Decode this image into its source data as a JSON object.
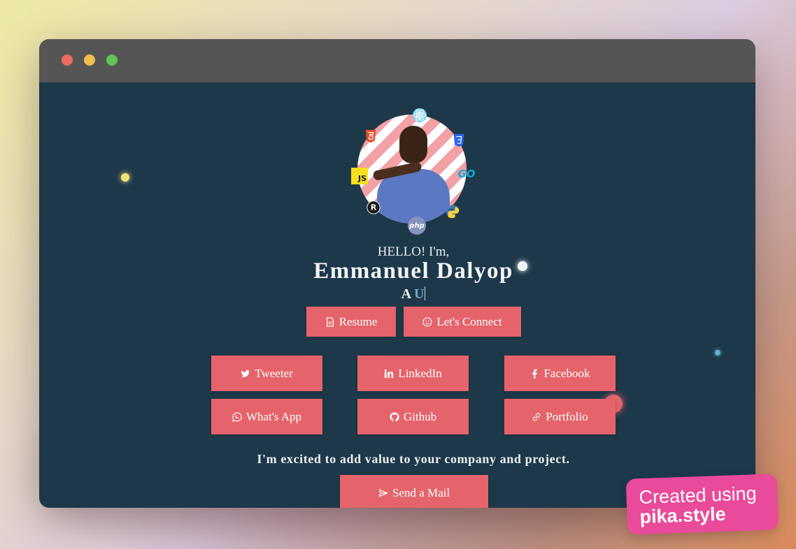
{
  "window": {
    "controls": [
      "close",
      "minimize",
      "zoom"
    ]
  },
  "profile": {
    "hello": "HELLO! I'm,",
    "name": "Emmanuel Dalyop",
    "typed_prefix": "A",
    "typed_text": "U",
    "tech_icons": [
      "html5-icon",
      "react-icon",
      "css3-icon",
      "javascript-icon",
      "go-icon",
      "rust-icon",
      "php-icon",
      "python-icon"
    ]
  },
  "actions": {
    "resume": "Resume",
    "connect": "Let's Connect"
  },
  "social": {
    "tweeter": "Tweeter",
    "linkedin": "LinkedIn",
    "facebook": "Facebook",
    "whatsapp": "What's App",
    "github": "Github",
    "portfolio": "Portfolio"
  },
  "tagline": "I'm excited to add value to your company and project.",
  "mail_button": "Send a Mail",
  "watermark": {
    "line1": "Created using",
    "line2": "pika.style"
  },
  "colors": {
    "page_bg": "#1d3849",
    "button": "#e5646b",
    "accent": "#6ea6d6",
    "badge": "#e94a9a"
  }
}
